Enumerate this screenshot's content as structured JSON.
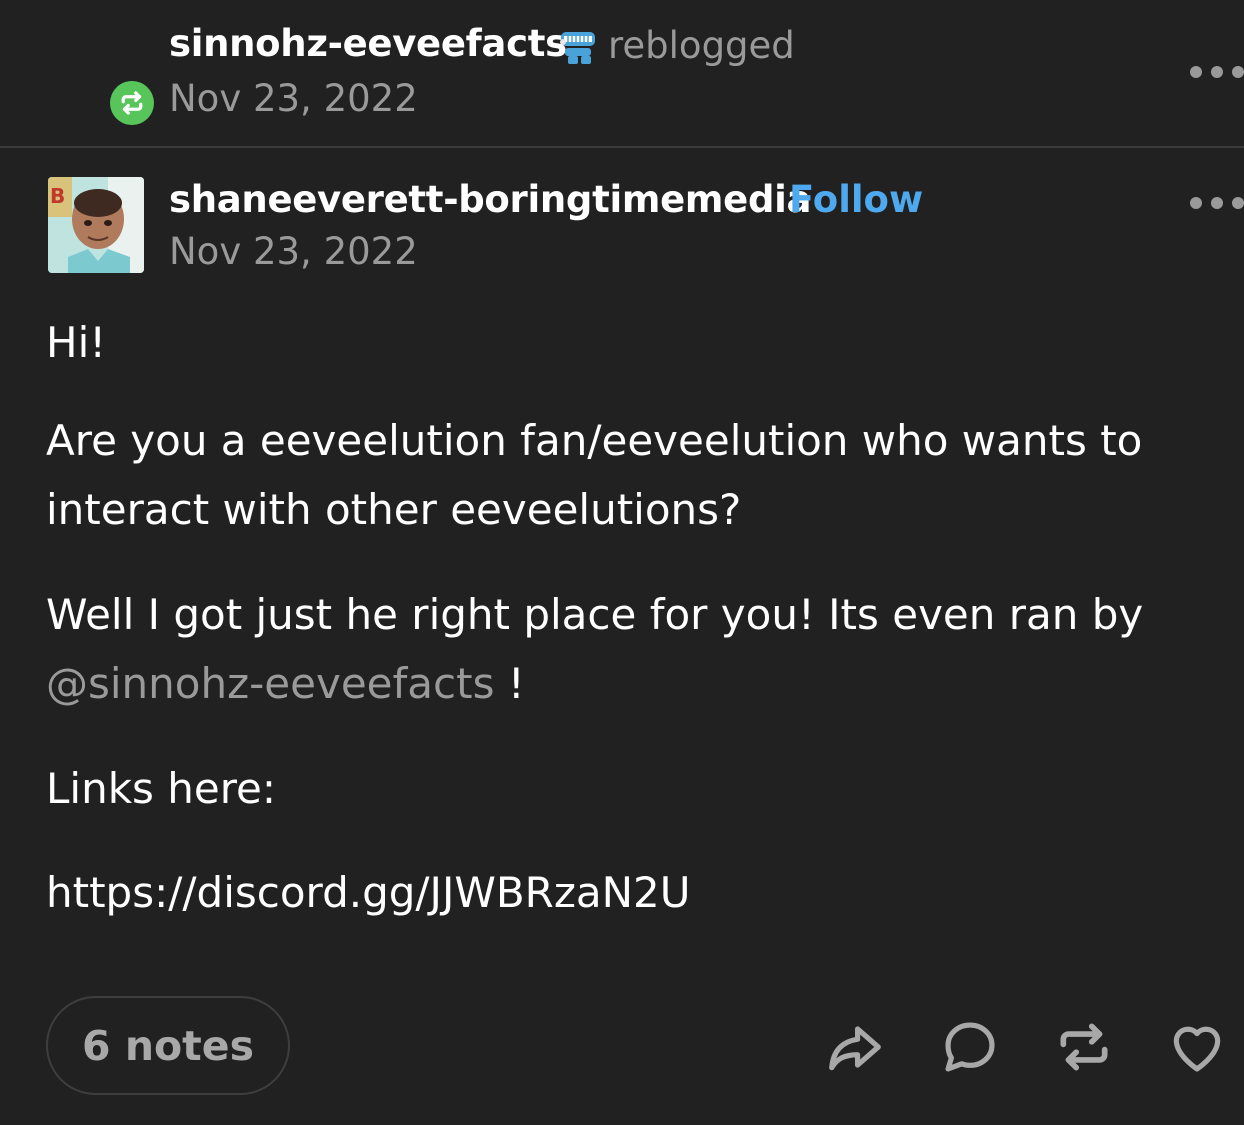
{
  "reblog": {
    "username": "sinnohz-eeveefacts",
    "verb": "reblogged",
    "date": "Nov 23, 2022",
    "badge_icon": "chattering-teeth-badge-icon",
    "reblog_icon": "reblog-icon",
    "reblog_icon_color": "#57c55a"
  },
  "post": {
    "author": "shaneeverett-boringtimemedia",
    "follow_label": "Follow",
    "date": "Nov 23, 2022",
    "greeting": "Hi!",
    "question": "Are you a eeveelution fan/eeveelution who wants to interact with other eeveelutions?",
    "promo_text": "Well I got just he right place for you! Its even ran by",
    "mention": "@sinnohz-eeveefacts",
    "promo_end": " !",
    "links_label": "Links here:",
    "url": "https://discord.gg/JJWBRzaN2U"
  },
  "footer": {
    "notes_label": "6 notes",
    "actions": [
      "share-icon",
      "comment-icon",
      "reblog-icon",
      "like-heart-icon"
    ]
  },
  "colors": {
    "background": "#212121",
    "accent_link": "#4fa9ee",
    "muted_text": "#9a9a9a"
  }
}
